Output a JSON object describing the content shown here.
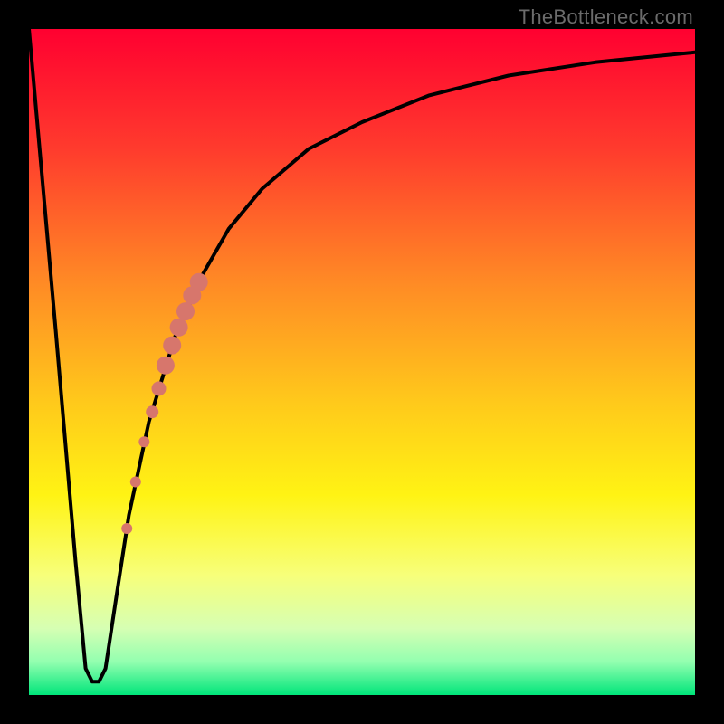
{
  "watermark": "TheBottleneck.com",
  "colors": {
    "bg": "#000000",
    "curve": "#000000",
    "marker": "#d7766c",
    "gradient_stops": [
      {
        "offset": 0.0,
        "color": "#ff0030"
      },
      {
        "offset": 0.18,
        "color": "#ff3b2d"
      },
      {
        "offset": 0.38,
        "color": "#ff8a25"
      },
      {
        "offset": 0.56,
        "color": "#ffc91b"
      },
      {
        "offset": 0.7,
        "color": "#fff314"
      },
      {
        "offset": 0.82,
        "color": "#f7ff7a"
      },
      {
        "offset": 0.9,
        "color": "#d6ffb3"
      },
      {
        "offset": 0.95,
        "color": "#93ffb0"
      },
      {
        "offset": 1.0,
        "color": "#00e57a"
      }
    ]
  },
  "chart_data": {
    "type": "line",
    "title": "",
    "xlabel": "",
    "ylabel": "",
    "xlim": [
      0,
      100
    ],
    "ylim": [
      0,
      100
    ],
    "series": [
      {
        "name": "curve",
        "x": [
          0,
          4,
          7,
          8.5,
          9.5,
          10.5,
          11.5,
          13,
          15,
          18,
          22,
          26,
          30,
          35,
          42,
          50,
          60,
          72,
          85,
          100
        ],
        "y": [
          100,
          55,
          20,
          4,
          2,
          2,
          4,
          14,
          27,
          41,
          54,
          63,
          70,
          76,
          82,
          86,
          90,
          93,
          95,
          96.5
        ]
      }
    ],
    "markers": {
      "name": "highlight-points",
      "color": "#d7766c",
      "points": [
        {
          "x": 14.7,
          "y": 25.0,
          "r": 6
        },
        {
          "x": 16.0,
          "y": 32.0,
          "r": 6
        },
        {
          "x": 17.3,
          "y": 38.0,
          "r": 6
        },
        {
          "x": 18.5,
          "y": 42.5,
          "r": 7
        },
        {
          "x": 19.5,
          "y": 46.0,
          "r": 8
        },
        {
          "x": 20.5,
          "y": 49.5,
          "r": 10
        },
        {
          "x": 21.5,
          "y": 52.5,
          "r": 10
        },
        {
          "x": 22.5,
          "y": 55.2,
          "r": 10
        },
        {
          "x": 23.5,
          "y": 57.6,
          "r": 10
        },
        {
          "x": 24.5,
          "y": 60.0,
          "r": 10
        },
        {
          "x": 25.5,
          "y": 62.0,
          "r": 10
        }
      ]
    }
  }
}
